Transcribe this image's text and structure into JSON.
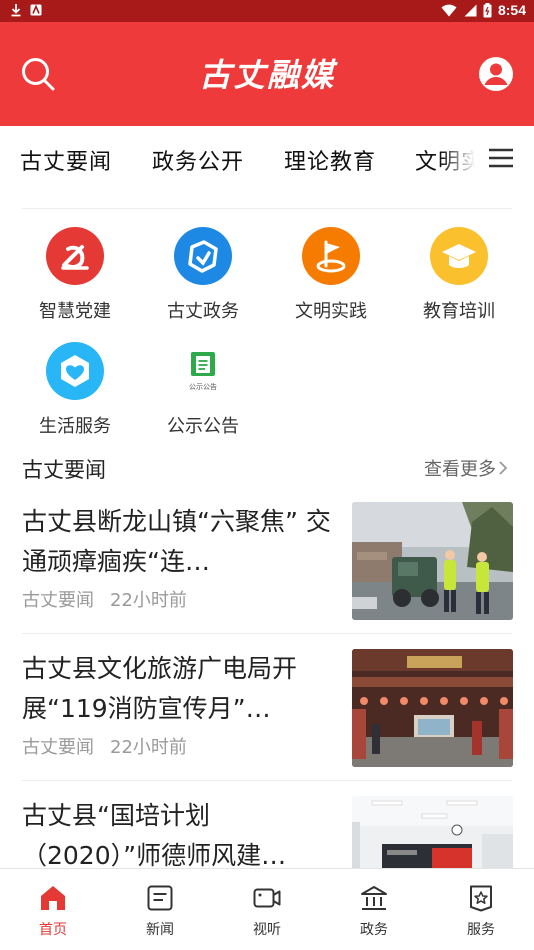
{
  "status_bar": {
    "time": "8:54"
  },
  "header": {
    "logo_text": "古丈融媒"
  },
  "tabs": [
    {
      "label": "古丈要闻"
    },
    {
      "label": "政务公开"
    },
    {
      "label": "理论教育"
    },
    {
      "label": "文明实"
    }
  ],
  "quick_links": [
    {
      "label": "智慧党建",
      "icon": "party-icon",
      "color": "#e53935"
    },
    {
      "label": "古丈政务",
      "icon": "government-icon",
      "color": "#1e88e5"
    },
    {
      "label": "文明实践",
      "icon": "flag-icon",
      "color": "#f57c00"
    },
    {
      "label": "教育培训",
      "icon": "graduation-cap-icon",
      "color": "#fbc02d"
    },
    {
      "label": "生活服务",
      "icon": "heart-shield-icon",
      "color": "#29b6f6"
    },
    {
      "label": "公示公告",
      "icon": "notice-icon",
      "color": "#2eaa4a",
      "caption": "公示公告"
    }
  ],
  "section": {
    "title": "古丈要闻",
    "more_label": "查看更多"
  },
  "news": [
    {
      "title": "古丈县断龙山镇“六聚焦” 交通顽瘴痼疾“连…",
      "source": "古丈要闻",
      "time": "22小时前"
    },
    {
      "title": "古丈县文化旅游广电局开展“119消防宣传月”…",
      "source": "古丈要闻",
      "time": "22小时前"
    },
    {
      "title": "古丈县“国培计划（2020）”师德师风建…",
      "source": "",
      "time": ""
    }
  ],
  "bottom_nav": [
    {
      "label": "首页",
      "icon": "home-icon",
      "active": true
    },
    {
      "label": "新闻",
      "icon": "news-icon",
      "active": false
    },
    {
      "label": "视听",
      "icon": "video-icon",
      "active": false
    },
    {
      "label": "政务",
      "icon": "government-building-icon",
      "active": false
    },
    {
      "label": "服务",
      "icon": "service-icon",
      "active": false
    }
  ],
  "colors": {
    "brand_red": "#ee3a3a",
    "status_bar": "#a81a1a",
    "active_nav": "#e53935"
  }
}
